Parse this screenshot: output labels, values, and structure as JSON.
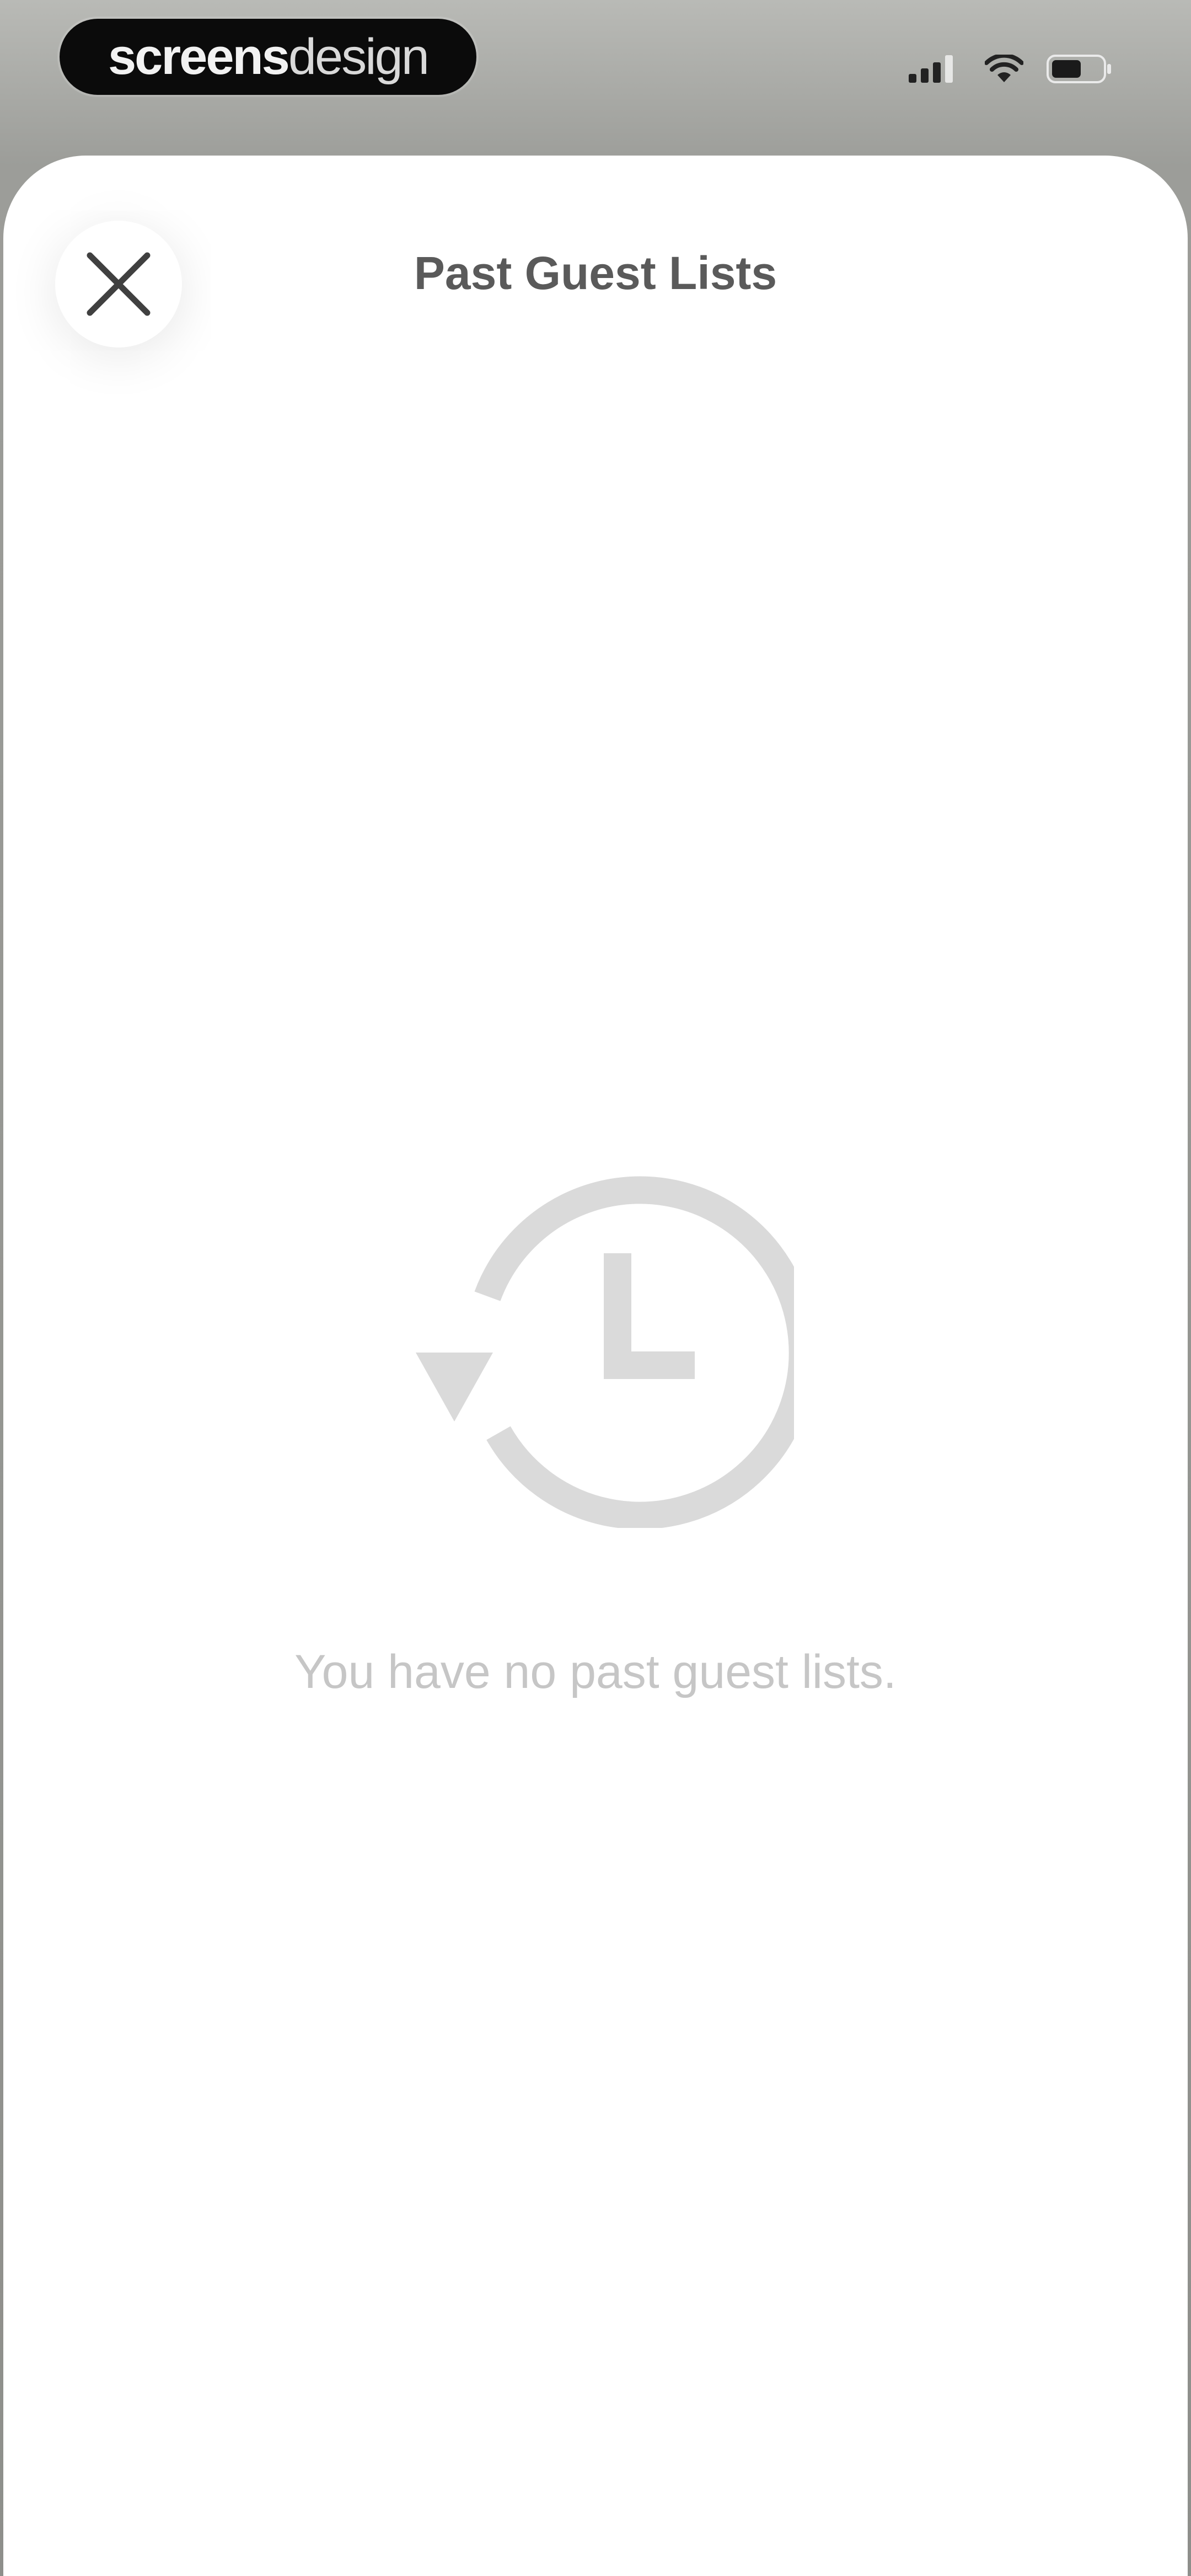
{
  "status_bar": {
    "brand": {
      "strong": "screens",
      "light": "design"
    },
    "icons": [
      "cellular-signal-icon",
      "wifi-icon",
      "battery-icon"
    ]
  },
  "sheet": {
    "title": "Past Guest Lists",
    "close_icon": "close-icon",
    "empty_state": {
      "icon": "history-clock-icon",
      "message": "You have no past guest lists."
    }
  },
  "colors": {
    "background": "#9c9d99",
    "sheet": "#ffffff",
    "title": "#5a5a5a",
    "icon_muted": "#d9d9d9",
    "message": "#c6c6c6"
  }
}
